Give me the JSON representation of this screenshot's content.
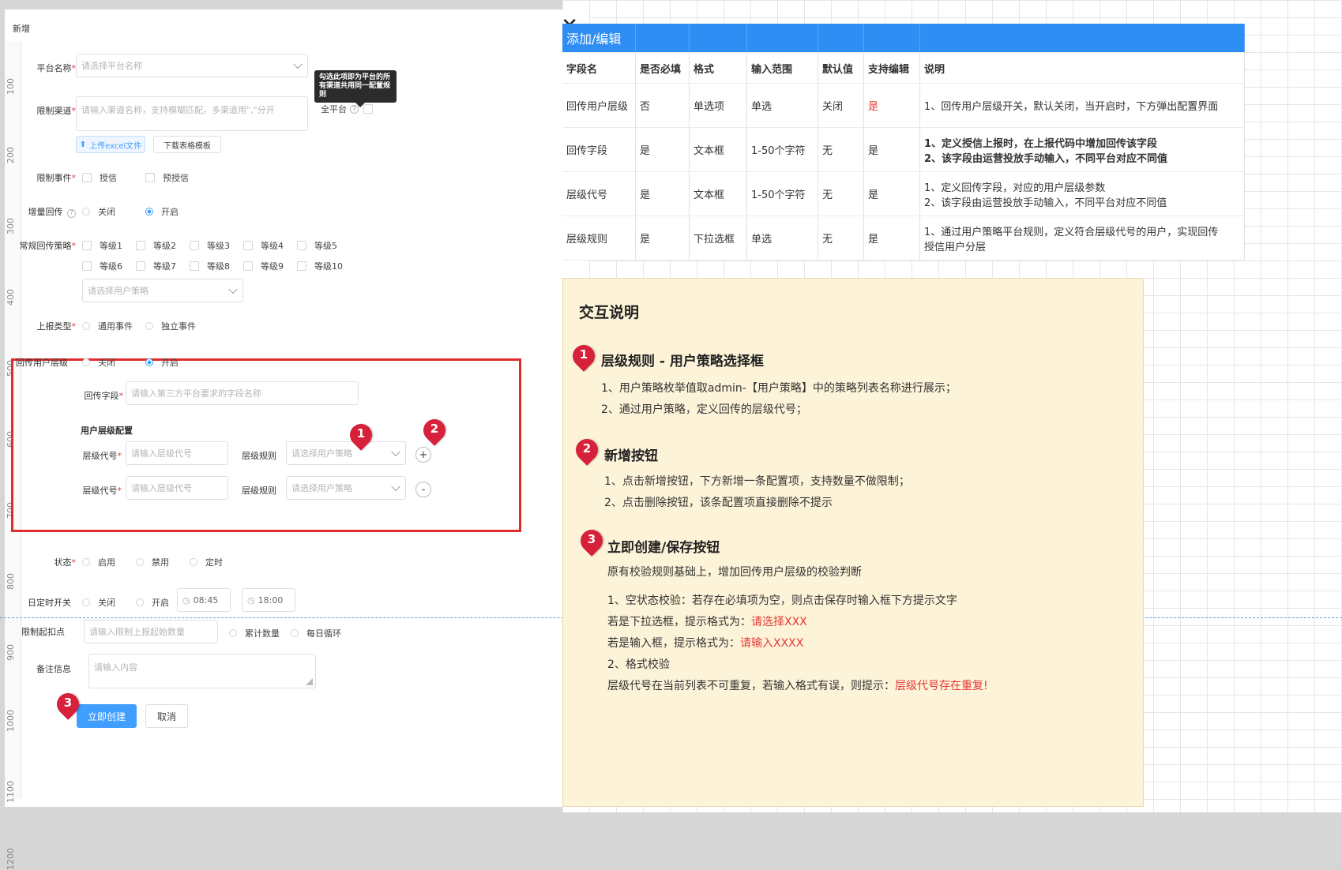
{
  "dialog": {
    "title": "新增",
    "close": "✕",
    "ruler": [
      "100",
      "200",
      "300",
      "400",
      "500",
      "600",
      "700",
      "800",
      "900",
      "1000",
      "1100",
      "1200"
    ],
    "platform": {
      "label": "平台名称",
      "req": "*",
      "placeholder": "请选择平台名称"
    },
    "tooltip": "勾选此项即为平台的所有渠道共用同一配置规则",
    "channel": {
      "label": "限制渠道",
      "req": "*",
      "placeholder": "请输入渠道名称，支持模糊匹配，多渠道用\",\"分开",
      "all_platform": "全平台",
      "upload": "上传excel文件",
      "download": "下载表格模板"
    },
    "events": {
      "label": "限制事件",
      "req": "*",
      "opt1": "授信",
      "opt2": "预授信"
    },
    "incremental": {
      "label": "增量回传",
      "opt1": "关闭",
      "opt2": "开启"
    },
    "strategy": {
      "label": "常规回传策略",
      "req": "*",
      "levels": [
        "等级1",
        "等级2",
        "等级3",
        "等级4",
        "等级5",
        "等级6",
        "等级7",
        "等级8",
        "等级9",
        "等级10"
      ],
      "placeholder": "请选择用户策略"
    },
    "report_type": {
      "label": "上报类型",
      "req": "*",
      "opt1": "通用事件",
      "opt2": "独立事件"
    },
    "user_level": {
      "label": "回传用户层级",
      "opt1": "关闭",
      "opt2": "开启"
    },
    "return_field": {
      "label": "回传字段",
      "req": "*",
      "placeholder": "请输入第三方平台要求的字段名称"
    },
    "level_config": {
      "title": "用户层级配置",
      "code_label": "层级代号",
      "req": "*",
      "code_placeholder": "请输入层级代号",
      "rule_label": "层级规则",
      "rule_placeholder": "请选择用户策略",
      "add": "+",
      "remove": "-"
    },
    "status": {
      "label": "状态",
      "req": "*",
      "opt1": "启用",
      "opt2": "禁用",
      "opt3": "定时"
    },
    "daily_switch": {
      "label": "日定时开关",
      "opt1": "关闭",
      "opt2": "开启",
      "time1": "08:45",
      "time2": "18:00"
    },
    "limit_start": {
      "label": "限制起扣点",
      "placeholder": "请输入限制上报起始数量",
      "opt1": "累计数量",
      "opt2": "每日循环"
    },
    "remark": {
      "label": "备注信息",
      "placeholder": "请输入内容"
    },
    "create": "立即创建",
    "cancel": "取消",
    "pins": [
      "1",
      "2",
      "3"
    ]
  },
  "spec": {
    "header": "添加/编辑",
    "columns": [
      "字段名",
      "是否必填",
      "格式",
      "输入范围",
      "默认值",
      "支持编辑",
      "说明"
    ],
    "rows": [
      [
        "回传用户层级",
        "否",
        "单选项",
        "单选",
        "关闭",
        "是",
        "1、回传用户层级开关，默认关闭，当开启时，下方弹出配置界面"
      ],
      [
        "回传字段",
        "是",
        "文本框",
        "1-50个字符",
        "无",
        "是",
        "1、定义授信上报时，在上报代码中增加回传该字段"
      ],
      [
        "层级代号",
        "是",
        "文本框",
        "1-50个字符",
        "无",
        "是",
        "1、定义回传字段，对应的用户层级参数"
      ],
      [
        "层级规则",
        "是",
        "下拉选框",
        "单选",
        "无",
        "是",
        "1、通过用户策略平台规则，定义符合层级代号的用户，实现回传"
      ]
    ],
    "row2_line2": "2、该字段由运营投放手动输入，不同平台对应不同值",
    "row3_line2": "2、该字段由运营投放手动输入，不同平台对应不同值",
    "row4_line2": "授信用户分层"
  },
  "notes": {
    "title": "交互说明",
    "s1_title": "层级规则 - 用户策略选择框",
    "s1_p1": "1、用户策略枚举值取admin-【用户策略】中的策略列表名称进行展示；",
    "s1_p2": "2、通过用户策略，定义回传的层级代号；",
    "s2_title": "新增按钮",
    "s2_p1": "1、点击新增按钮，下方新增一条配置项，支持数量不做限制；",
    "s2_p2": "2、点击删除按钮，该条配置项直接删除不提示",
    "s3_title": "立即创建/保存按钮",
    "s3_p1": "原有校验规则基础上，增加回传用户层级的校验判断",
    "s3_p2": "1、空状态校验：若存在必填项为空，则点击保存时输入框下方提示文字",
    "s3_p3a": "若是下拉选框，提示格式为：",
    "s3_p3b": "请选择XXX",
    "s3_p4a": "若是输入框，提示格式为：",
    "s3_p4b": "请输入XXXX",
    "s3_p5": "2、格式校验",
    "s3_p6a": "层级代号在当前列表不可重复，若输入格式有误，则提示：",
    "s3_p6b": "层级代号存在重复!"
  }
}
